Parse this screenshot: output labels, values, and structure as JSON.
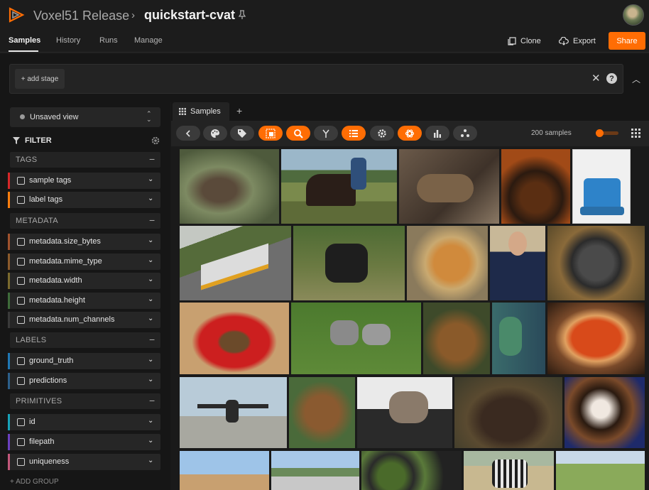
{
  "header": {
    "team": "Voxel51 Release",
    "dataset": "quickstart-cvat"
  },
  "nav": {
    "tabs": [
      "Samples",
      "History",
      "Runs",
      "Manage"
    ],
    "clone": "Clone",
    "export": "Export",
    "share": "Share"
  },
  "viewbar": {
    "add_stage": "+ add stage"
  },
  "sidebar": {
    "saved_view": "Unsaved view",
    "filter_label": "FILTER",
    "groups": [
      {
        "label": "TAGS",
        "fields": [
          "sample tags",
          "label tags"
        ]
      },
      {
        "label": "METADATA",
        "fields": [
          "metadata.size_bytes",
          "metadata.mime_type",
          "metadata.width",
          "metadata.height",
          "metadata.num_channels"
        ]
      },
      {
        "label": "LABELS",
        "fields": [
          "ground_truth",
          "predictions"
        ]
      },
      {
        "label": "PRIMITIVES",
        "fields": [
          "id",
          "filepath",
          "uniqueness"
        ]
      }
    ],
    "add_group": "+ ADD GROUP",
    "colors": {
      "sample tags": "#d62728",
      "label tags": "#ff7f0e",
      "metadata": "#a0522d",
      "labels": "#1f77b4",
      "id": "#17a2b8",
      "filepath": "#6a3fbf",
      "uniqueness": "#c2577a"
    }
  },
  "main": {
    "tab": "Samples",
    "count": "200 samples",
    "actions": [
      {
        "icon": "back-icon",
        "active": false
      },
      {
        "icon": "palette-icon",
        "active": false
      },
      {
        "icon": "tag-icon",
        "active": false
      },
      {
        "icon": "patches-icon",
        "active": true
      },
      {
        "icon": "search-icon",
        "active": true
      },
      {
        "icon": "merge-icon",
        "active": false
      },
      {
        "icon": "list-icon",
        "active": true
      },
      {
        "icon": "gear-icon",
        "active": false
      },
      {
        "icon": "openai-icon",
        "active": true
      },
      {
        "icon": "chart-icon",
        "active": false
      },
      {
        "icon": "embeddings-icon",
        "active": false
      }
    ]
  },
  "colors": {
    "accent": "#ff6d04",
    "background": "#1a1a1a",
    "panel": "#232323"
  },
  "images": [
    "turkey",
    "cowboy-on-horse",
    "cat-on-bed",
    "dinner-plate",
    "birthday-cake",
    "train",
    "cow",
    "cat-in-mirror",
    "man-in-suit",
    "cat-in-bowl",
    "food-plate",
    "dogs-on-grass",
    "brown-bear",
    "boy-with-toy",
    "pizza",
    "airplane",
    "bear-in-grass",
    "cat-in-window",
    "bears-fighting",
    "dog-in-car",
    "dog-ears",
    "street-cars",
    "broccoli",
    "zebras",
    "zebra-field"
  ]
}
